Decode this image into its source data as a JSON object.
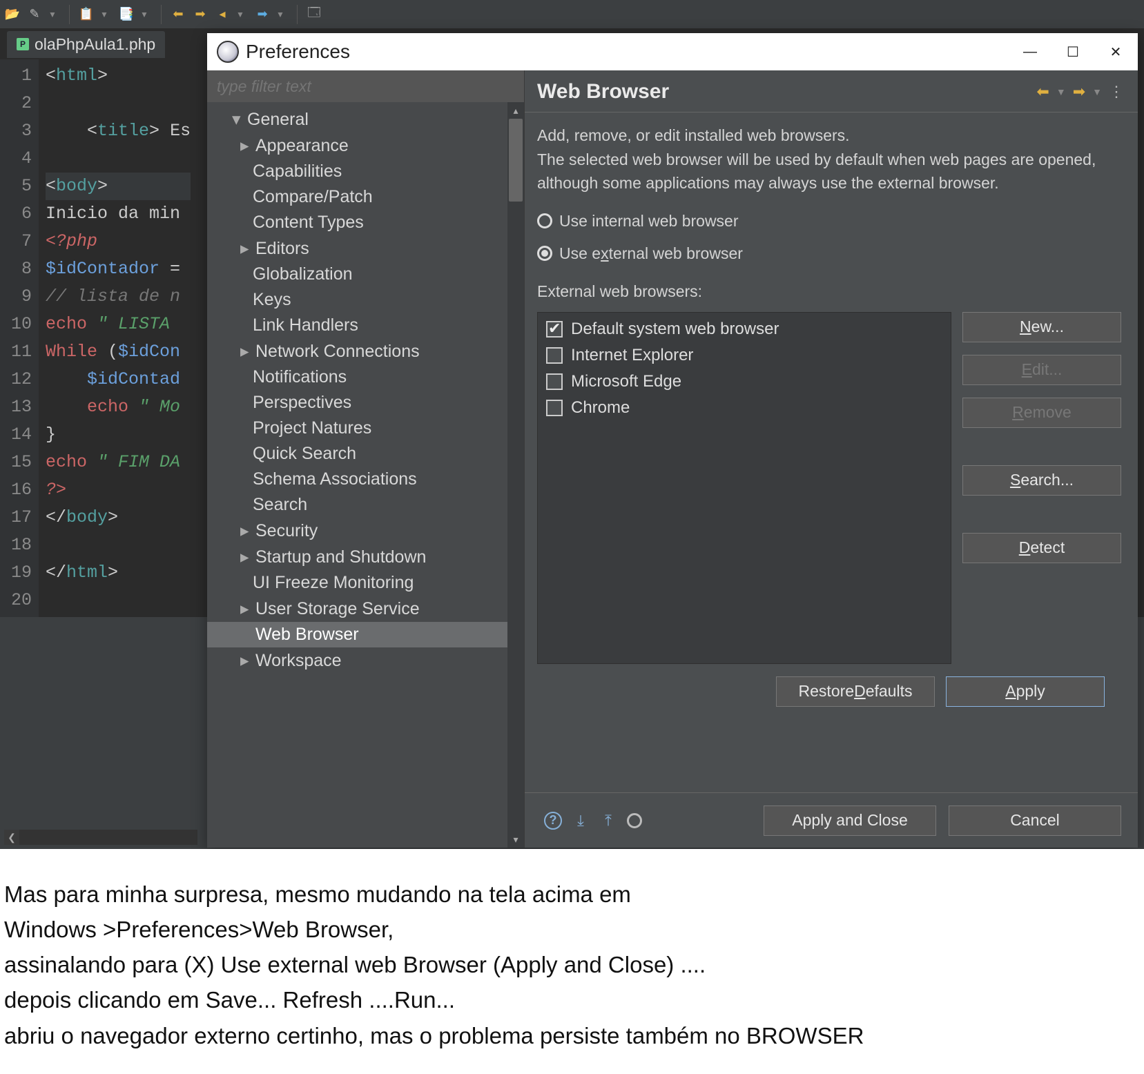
{
  "toolbar": {},
  "editor": {
    "tab_filename": "olaPhpAula1.php",
    "lines": [
      {
        "n": 1,
        "html": "<span class='c-punct'>&lt;</span><span class='c-tag'>html</span><span class='c-punct'>&gt;</span>"
      },
      {
        "n": 2,
        "html": ""
      },
      {
        "n": 3,
        "html": "    <span class='c-punct'>&lt;</span><span class='c-tag'>title</span><span class='c-punct'>&gt;</span> Es"
      },
      {
        "n": 4,
        "html": ""
      },
      {
        "n": 5,
        "html": "<span class='c-punct'>&lt;</span><span class='c-tag'>body</span><span class='c-punct'>&gt;</span>",
        "hl": true
      },
      {
        "n": 6,
        "html": "Inicio da min"
      },
      {
        "n": 7,
        "html": "<span class='c-php'>&lt;?php</span>"
      },
      {
        "n": 8,
        "html": "<span class='c-var'>$idContador</span> ="
      },
      {
        "n": 9,
        "html": "<span class='c-cmt'>// lista de n</span>"
      },
      {
        "n": 10,
        "html": "<span class='c-keyword'>echo</span> <span class='c-str'>\" LISTA </span>"
      },
      {
        "n": 11,
        "html": "<span class='c-keyword'>While</span> (<span class='c-var'>$idCon</span>"
      },
      {
        "n": 12,
        "html": "    <span class='c-var'>$idContad</span>"
      },
      {
        "n": 13,
        "html": "    <span class='c-keyword'>echo</span> <span class='c-str'>\" Mo</span>"
      },
      {
        "n": 14,
        "html": "}"
      },
      {
        "n": 15,
        "html": "<span class='c-keyword'>echo</span> <span class='c-str'>\" FIM DA</span>"
      },
      {
        "n": 16,
        "html": "<span class='c-php'>?&gt;</span>"
      },
      {
        "n": 17,
        "html": "<span class='c-punct'>&lt;/</span><span class='c-tag'>body</span><span class='c-punct'>&gt;</span>"
      },
      {
        "n": 18,
        "html": ""
      },
      {
        "n": 19,
        "html": "<span class='c-punct'>&lt;/</span><span class='c-tag'>html</span><span class='c-punct'>&gt;</span>"
      },
      {
        "n": 20,
        "html": ""
      }
    ]
  },
  "pref": {
    "title": "Preferences",
    "filter_placeholder": "type filter text",
    "tree": [
      {
        "label": "General",
        "level": 0,
        "arrow": "down"
      },
      {
        "label": "Appearance",
        "level": 1,
        "arrow": "right"
      },
      {
        "label": "Capabilities",
        "level": 1
      },
      {
        "label": "Compare/Patch",
        "level": 1
      },
      {
        "label": "Content Types",
        "level": 1
      },
      {
        "label": "Editors",
        "level": 1,
        "arrow": "right"
      },
      {
        "label": "Globalization",
        "level": 1
      },
      {
        "label": "Keys",
        "level": 1
      },
      {
        "label": "Link Handlers",
        "level": 1
      },
      {
        "label": "Network Connections",
        "level": 1,
        "arrow": "right"
      },
      {
        "label": "Notifications",
        "level": 1
      },
      {
        "label": "Perspectives",
        "level": 1
      },
      {
        "label": "Project Natures",
        "level": 1
      },
      {
        "label": "Quick Search",
        "level": 1
      },
      {
        "label": "Schema Associations",
        "level": 1
      },
      {
        "label": "Search",
        "level": 1
      },
      {
        "label": "Security",
        "level": 1,
        "arrow": "right"
      },
      {
        "label": "Startup and Shutdown",
        "level": 1,
        "arrow": "right"
      },
      {
        "label": "UI Freeze Monitoring",
        "level": 1
      },
      {
        "label": "User Storage Service",
        "level": 1,
        "arrow": "right"
      },
      {
        "label": "Web Browser",
        "level": 1,
        "selected": true
      },
      {
        "label": "Workspace",
        "level": 1,
        "arrow": "right"
      }
    ],
    "page_title": "Web Browser",
    "description": "Add, remove, or edit installed web browsers.\nThe selected web browser will be used by default when web pages are opened, although some applications may always use the external browser.",
    "radio_internal": "Use internal web browser",
    "radio_external_pre": "Use e",
    "radio_external_ul": "x",
    "radio_external_post": "ternal web browser",
    "external_label": "External web browsers:",
    "browsers": [
      {
        "label": "Default system web browser",
        "checked": true
      },
      {
        "label": "Internet Explorer",
        "checked": false
      },
      {
        "label": "Microsoft Edge",
        "checked": false
      },
      {
        "label": "Chrome",
        "checked": false
      }
    ],
    "btn_new_pre": "",
    "btn_new_ul": "N",
    "btn_new_post": "ew...",
    "btn_edit_pre": "",
    "btn_edit_ul": "E",
    "btn_edit_post": "dit...",
    "btn_remove_pre": "",
    "btn_remove_ul": "R",
    "btn_remove_post": "emove",
    "btn_search_pre": "",
    "btn_search_ul": "S",
    "btn_search_post": "earch...",
    "btn_detect_pre": "",
    "btn_detect_ul": "D",
    "btn_detect_post": "etect",
    "btn_restore_pre": "Restore ",
    "btn_restore_ul": "D",
    "btn_restore_post": "efaults",
    "btn_apply_pre": "",
    "btn_apply_ul": "A",
    "btn_apply_post": "pply",
    "btn_apply_close": "Apply and Close",
    "btn_cancel": "Cancel"
  },
  "below": {
    "l1": "Mas para minha surpresa, mesmo mudando na tela acima em",
    "l2": "Windows >Preferences>Web Browser,",
    "l3": "assinalando para (X) Use external web Browser (Apply and Close) ....",
    "l4": "depois clicando em Save... Refresh ....Run...",
    "l5": "abriu o navegador externo certinho, mas o problema persiste também no BROWSER"
  }
}
